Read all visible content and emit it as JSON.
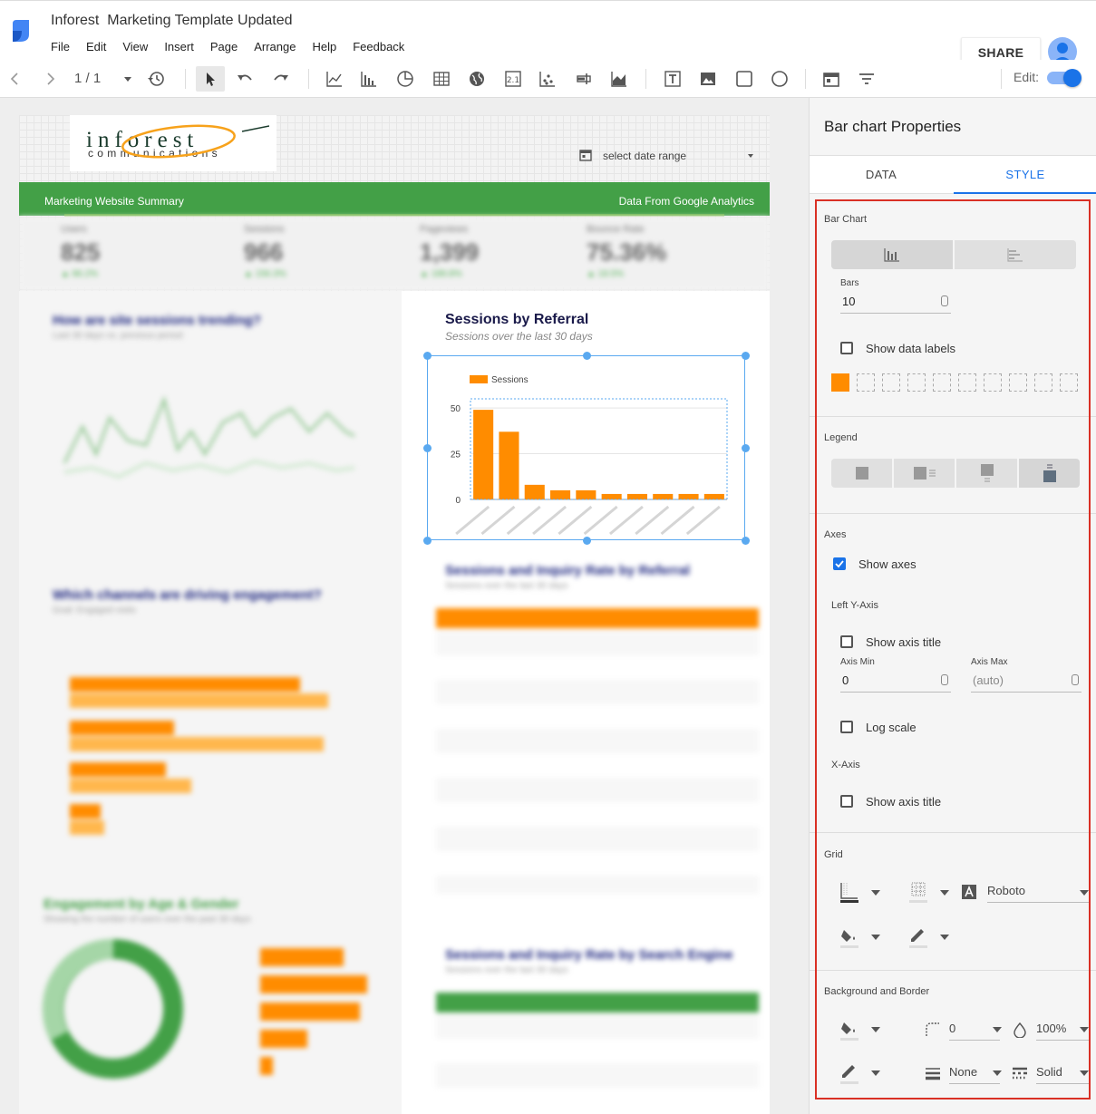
{
  "app": {
    "title": "Inforest  Marketing Template Updated",
    "menu": [
      "File",
      "Edit",
      "View",
      "Insert",
      "Page",
      "Arrange",
      "Help",
      "Feedback"
    ],
    "share_label": "SHARE"
  },
  "toolbar": {
    "page_indicator": "1 / 1",
    "edit_label": "Edit:",
    "edit_enabled": true
  },
  "report": {
    "logo_main": "inforest",
    "logo_sub": "communications",
    "date_range_label": "select date range",
    "banner_left": "Marketing Website Summary",
    "banner_right": "Data From Google Analytics",
    "kpis": [
      {
        "name": "Users",
        "value": "825",
        "delta": "▲ 86.2%"
      },
      {
        "name": "Sessions",
        "value": "966",
        "delta": "▲ 156.3%"
      },
      {
        "name": "Pageviews",
        "value": "1,399",
        "delta": "▲ 189.8%"
      },
      {
        "name": "Bounce Rate",
        "value": "75.36%",
        "delta": "▲ 18.5%"
      }
    ],
    "left_titles": [
      {
        "title": "How are site sessions trending?",
        "sub": "Last 30 days vs. previous period"
      },
      {
        "title": "Which channels are driving engagement?",
        "sub": "Goal: Engaged visits"
      },
      {
        "title": "Engagement by Age & Gender",
        "sub": "Showing the number of users over the past 30 days"
      }
    ],
    "right_titles": [
      {
        "title": "Sessions and Inquiry Rate by Referral",
        "sub": "Sessions over the last 30 days"
      },
      {
        "title": "Sessions and Inquiry Rate by Search Engine",
        "sub": "Sessions over the last 30 days"
      }
    ],
    "referral_title": "Sessions by Referral",
    "referral_subtitle": "Sessions over the last 30 days"
  },
  "chart_data": {
    "type": "bar",
    "legend": "Sessions",
    "series": [
      {
        "name": "Sessions",
        "values": [
          49,
          37,
          8,
          5,
          5,
          3,
          3,
          3,
          3,
          3
        ]
      }
    ],
    "ylim": [
      0,
      55
    ],
    "yticks": [
      0,
      25,
      50
    ],
    "bar_color": "#ff8c00"
  },
  "panel": {
    "title": "Bar chart Properties",
    "tabs": [
      "DATA",
      "STYLE"
    ],
    "active_tab": "STYLE",
    "bar_chart": {
      "section_label": "Bar Chart",
      "bars_label": "Bars",
      "bars_value": "10",
      "show_data_labels": "Show data labels",
      "show_data_labels_checked": false,
      "series_color": "#ff8c00"
    },
    "legend": {
      "section_label": "Legend"
    },
    "axes": {
      "section_label": "Axes",
      "show_axes": "Show axes",
      "show_axes_checked": true,
      "left_y_axis": "Left Y-Axis",
      "show_axis_title": "Show axis title",
      "axis_min_label": "Axis Min",
      "axis_min_value": "0",
      "axis_max_label": "Axis Max",
      "axis_max_placeholder": "(auto)",
      "log_scale": "Log scale",
      "x_axis": "X-Axis",
      "show_x_axis_title": "Show axis title"
    },
    "grid": {
      "section_label": "Grid",
      "font": "Roboto"
    },
    "background": {
      "section_label": "Background and Border",
      "radius": "0",
      "opacity": "100%",
      "border_weight": "None",
      "border_style": "Solid"
    }
  }
}
